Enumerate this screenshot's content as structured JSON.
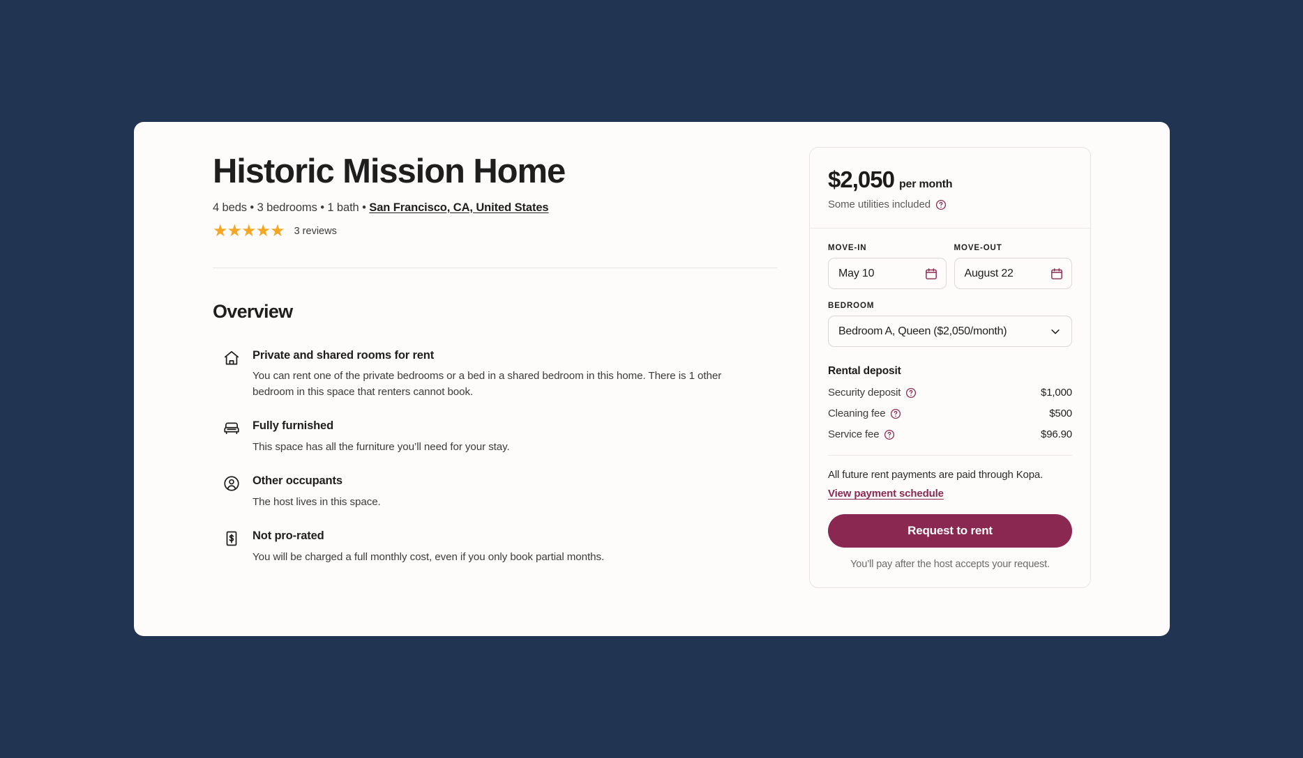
{
  "theme": {
    "page_background": "#213451",
    "card_background": "#FDFCFA",
    "accent": "#8A2852",
    "star_color": "#F5A623"
  },
  "listing": {
    "title": "Historic Mission Home",
    "meta_prefix": "4 beds • 3 bedrooms • 1 bath • ",
    "location": "San Francisco, CA, United States",
    "stars": "★★★★★",
    "reviews": "3 reviews"
  },
  "overview": {
    "heading": "Overview",
    "features": [
      {
        "icon": "house-icon",
        "title": "Private and shared rooms for rent",
        "desc": "You can rent one of the private bedrooms or a bed in a shared bedroom in this home. There is 1 other bedroom in this space that renters cannot book."
      },
      {
        "icon": "armchair-icon",
        "title": "Fully furnished",
        "desc": "This space has all the furniture you’ll need for your stay."
      },
      {
        "icon": "person-circle-icon",
        "title": "Other occupants",
        "desc": "The host lives in this space."
      },
      {
        "icon": "dollar-bill-icon",
        "title": "Not pro-rated",
        "desc": "You will be charged a full monthly cost, even if you only book partial months."
      }
    ]
  },
  "booking": {
    "price_amount": "$2,050",
    "price_period": "per month",
    "utilities_text": "Some utilities included",
    "movein_label": "MOVE-IN",
    "movein_value": "May 10",
    "moveout_label": "MOVE-OUT",
    "moveout_value": "August 22",
    "bedroom_label": "BEDROOM",
    "bedroom_value": "Bedroom A, Queen ($2,050/month)",
    "deposit_heading": "Rental deposit",
    "fees": [
      {
        "label": "Security deposit",
        "value": "$1,000"
      },
      {
        "label": "Cleaning fee",
        "value": "$500"
      },
      {
        "label": "Service fee",
        "value": "$96.90"
      }
    ],
    "payment_note": "All future rent payments are paid through Kopa.",
    "schedule_link": "View payment schedule",
    "request_button": "Request to rent",
    "after_note": "You’ll pay after the host accepts your request."
  }
}
